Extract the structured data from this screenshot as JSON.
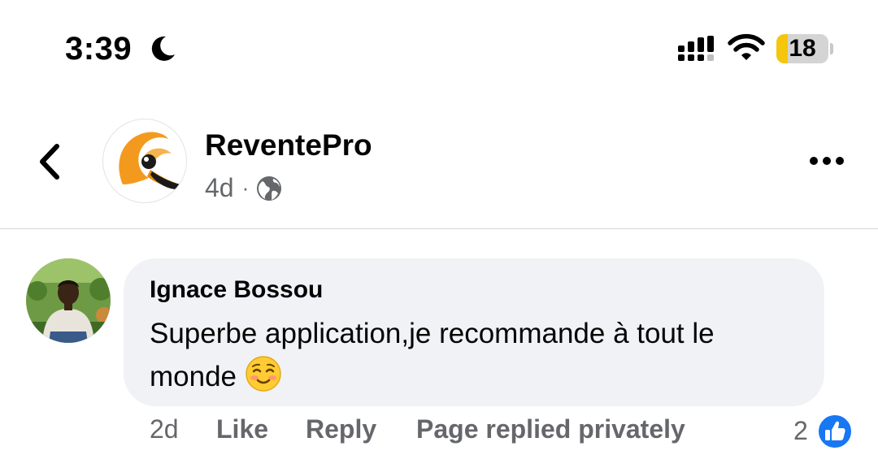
{
  "status_bar": {
    "time": "3:39",
    "battery_level": "18",
    "icons": [
      "moon-icon",
      "cellular-signal-icon",
      "wifi-icon",
      "battery-icon"
    ]
  },
  "post_header": {
    "page_name": "ReventePro",
    "post_time": "4d",
    "separator": "·",
    "audience_icon": "globe-icon",
    "back_icon": "chevron-left-icon",
    "more_icon": "more-horizontal-icon"
  },
  "comment": {
    "author": "Ignace Bossou",
    "text": "Superbe application,je recommande à tout le monde",
    "emoji_icon": "smiling-face-emoji",
    "actions": {
      "time": "2d",
      "like": "Like",
      "reply": "Reply",
      "page_status": "Page replied privately"
    },
    "reaction_count": "2",
    "reaction_icon": "like-reaction-icon"
  },
  "colors": {
    "text_primary": "#050505",
    "text_secondary": "#65676b",
    "bubble_bg": "#f0f2f5",
    "like_blue": "#1877f2",
    "logo_orange": "#f39a1e",
    "battery_yellow": "#f5c60b"
  }
}
